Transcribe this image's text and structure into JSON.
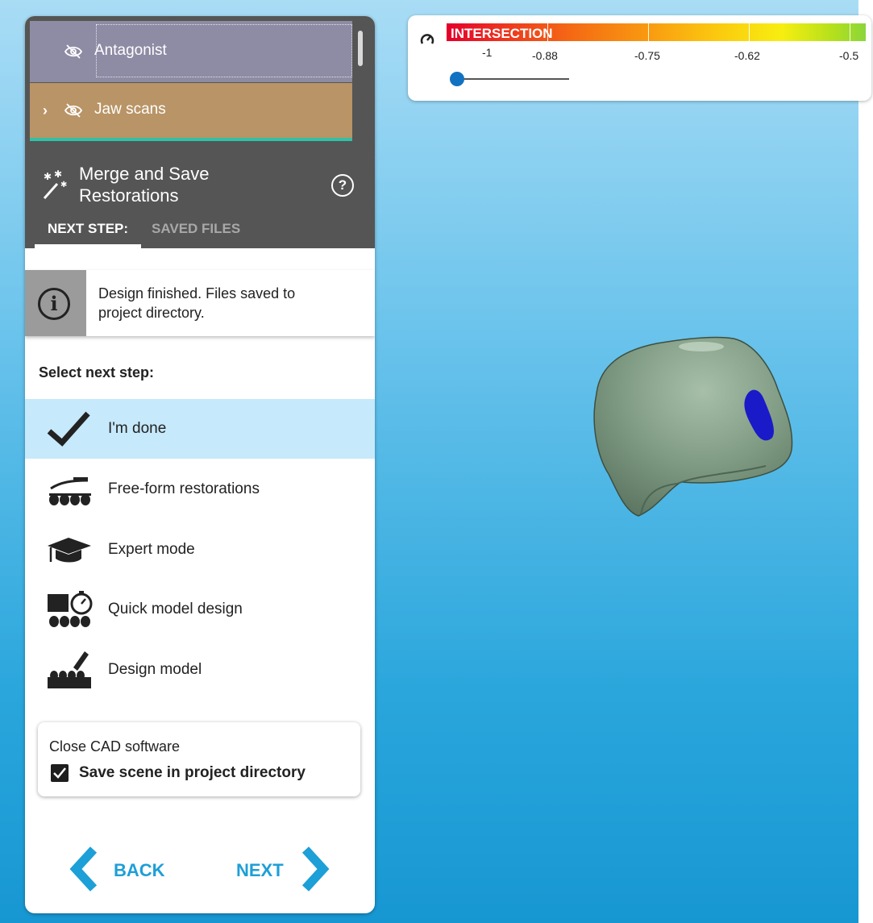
{
  "layers": {
    "antagonist_label": "Antagonist",
    "jaw_scans_label": "Jaw scans"
  },
  "step_panel": {
    "title_line1": "Merge and Save",
    "title_line2": "Restorations",
    "tabs": [
      {
        "label": "NEXT STEP:",
        "active": true
      },
      {
        "label": "SAVED FILES",
        "active": false
      }
    ]
  },
  "info": {
    "message": "Design finished. Files saved to project directory."
  },
  "next_step": {
    "heading": "Select next step:",
    "options": [
      {
        "label": "I'm done",
        "icon": "checkmark-icon",
        "selected": true
      },
      {
        "label": "Free-form restorations",
        "icon": "freeform-teeth-icon",
        "selected": false
      },
      {
        "label": "Expert mode",
        "icon": "graduation-cap-icon",
        "selected": false
      },
      {
        "label": "Quick model design",
        "icon": "stopwatch-model-icon",
        "selected": false
      },
      {
        "label": "Design model",
        "icon": "pen-model-icon",
        "selected": false
      }
    ]
  },
  "close_cad": {
    "title": "Close CAD software",
    "save_scene_label": "Save scene in project directory",
    "save_scene_checked": true
  },
  "navigation": {
    "back_label": "BACK",
    "next_label": "NEXT"
  },
  "intersection_scale": {
    "title": "INTERSECTION",
    "ticks": [
      "-1",
      "-0.88",
      "-0.75",
      "-0.62",
      "-0.5"
    ],
    "slider_value": "-1"
  },
  "colors": {
    "accent_blue": "#1d9fd7",
    "panel_dark": "#555555",
    "antagonist_bg": "#8e8ba4",
    "jaw_scans_bg": "#b99466",
    "selected_row": "#c6e9fb",
    "tooth_green": "#7f9a83",
    "intersection_spot": "#1a1ac8"
  }
}
